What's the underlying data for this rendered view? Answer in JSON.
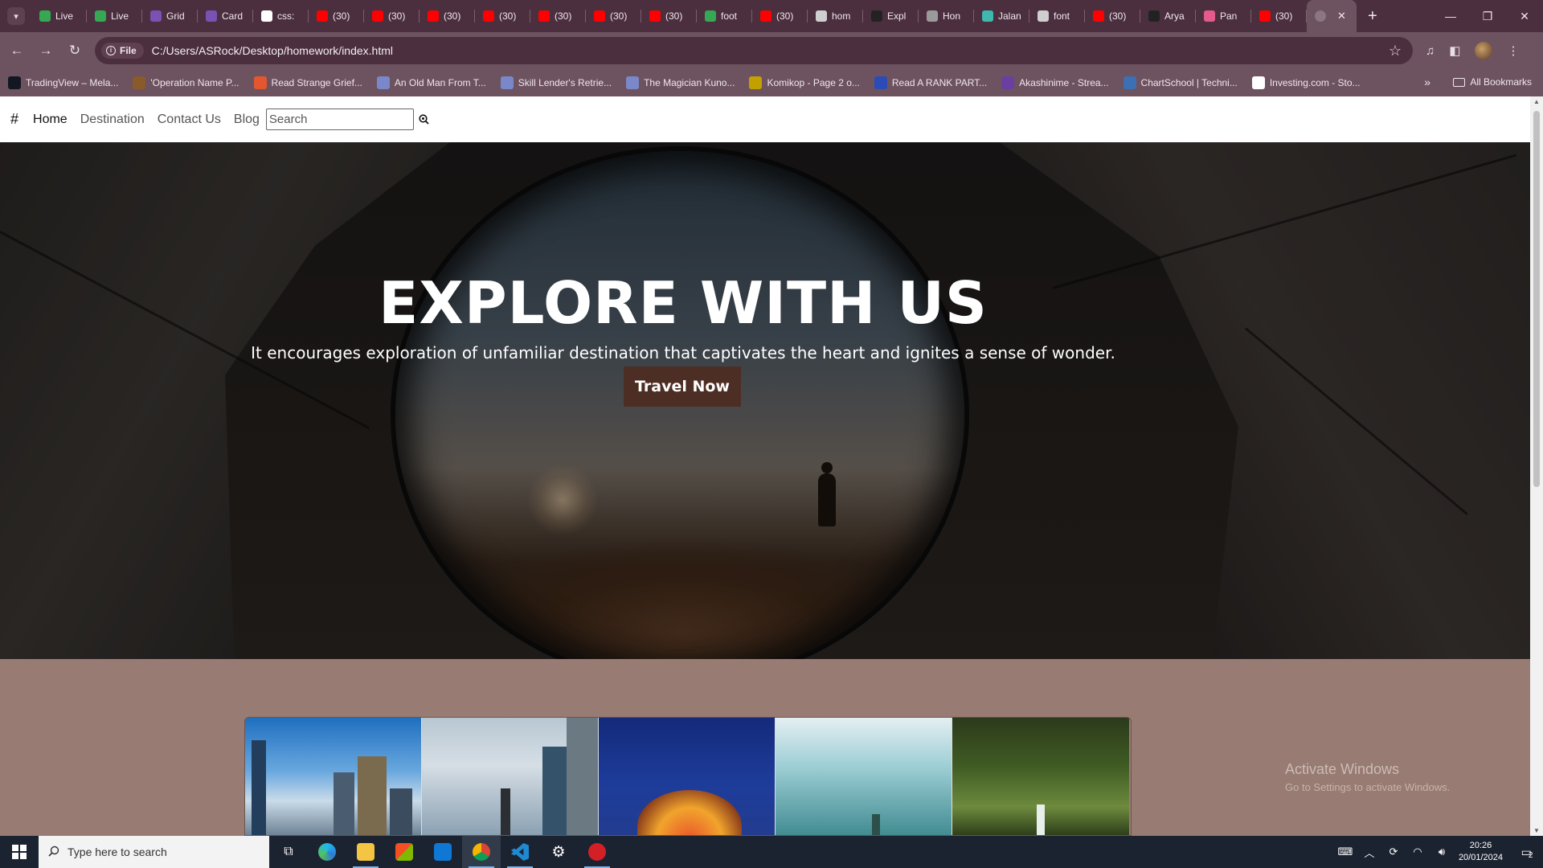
{
  "browser": {
    "tabs": [
      {
        "label": "Live",
        "icon": "google-drive-icon",
        "color": "#34a853"
      },
      {
        "label": "Live",
        "icon": "google-drive-icon",
        "color": "#34a853"
      },
      {
        "label": "Grid",
        "icon": "bootstrap-icon",
        "color": "#7952b3"
      },
      {
        "label": "Card",
        "icon": "bootstrap-icon",
        "color": "#7952b3"
      },
      {
        "label": "css:",
        "icon": "c-icon",
        "color": "#ffffff"
      },
      {
        "label": "(30)",
        "icon": "youtube-icon",
        "color": "#ff0000"
      },
      {
        "label": "(30)",
        "icon": "youtube-icon",
        "color": "#ff0000"
      },
      {
        "label": "(30)",
        "icon": "youtube-icon",
        "color": "#ff0000"
      },
      {
        "label": "(30)",
        "icon": "youtube-icon",
        "color": "#ff0000"
      },
      {
        "label": "(30)",
        "icon": "youtube-icon",
        "color": "#ff0000"
      },
      {
        "label": "(30)",
        "icon": "youtube-icon",
        "color": "#ff0000"
      },
      {
        "label": "(30)",
        "icon": "youtube-icon",
        "color": "#ff0000"
      },
      {
        "label": "foot",
        "icon": "google-drive-icon",
        "color": "#34a853"
      },
      {
        "label": "(30)",
        "icon": "youtube-icon",
        "color": "#ff0000"
      },
      {
        "label": "hom",
        "icon": "radio-icon",
        "color": "#cfcfcf"
      },
      {
        "label": "Expl",
        "icon": "github-icon",
        "color": "#222222"
      },
      {
        "label": "Hon",
        "icon": "globe-icon",
        "color": "#9a9a9a"
      },
      {
        "label": "Jalan",
        "icon": "d-icon",
        "color": "#3fb8af"
      },
      {
        "label": "font",
        "icon": "code-icon",
        "color": "#cfcfcf"
      },
      {
        "label": "(30)",
        "icon": "youtube-icon",
        "color": "#ff0000"
      },
      {
        "label": "Arya",
        "icon": "github-icon",
        "color": "#222222"
      },
      {
        "label": "Pan",
        "icon": "pan-icon",
        "color": "#e45b8b"
      },
      {
        "label": "(30)",
        "icon": "youtube-icon",
        "color": "#ff0000"
      }
    ],
    "active_tab_icon": "globe-icon",
    "address": {
      "chip": "File",
      "url": "C:/Users/ASRock/Desktop/homework/index.html"
    },
    "bookmarks": [
      {
        "label": "TradingView – Mela...",
        "icon": "tradingview-icon",
        "color": "#131722"
      },
      {
        "label": "'Operation Name P...",
        "icon": "book-icon",
        "color": "#8a5a2b"
      },
      {
        "label": "Read Strange Grief...",
        "icon": "k-icon",
        "color": "#e4572e"
      },
      {
        "label": "An Old Man From T...",
        "icon": "manga-icon",
        "color": "#7a88c9"
      },
      {
        "label": "Skill Lender's Retrie...",
        "icon": "manga-icon",
        "color": "#7a88c9"
      },
      {
        "label": "The Magician Kuno...",
        "icon": "manga-icon",
        "color": "#7a88c9"
      },
      {
        "label": "Komikop - Page 2 o...",
        "icon": "komik-icon",
        "color": "#c2a000"
      },
      {
        "label": "Read A RANK PART...",
        "icon": "rank-icon",
        "color": "#2a4bb8"
      },
      {
        "label": "Akashinime - Strea...",
        "icon": "akashi-icon",
        "color": "#6a3fa0"
      },
      {
        "label": "ChartSchool | Techni...",
        "icon": "chartschool-icon",
        "color": "#3c6fb3"
      },
      {
        "label": "Investing.com - Sto...",
        "icon": "investing-icon",
        "color": "#ffffff"
      }
    ],
    "all_bookmarks": "All Bookmarks"
  },
  "site": {
    "brand": "#",
    "nav": [
      "Home",
      "Destination",
      "Contact Us",
      "Blog"
    ],
    "search_placeholder": "Search",
    "hero": {
      "title": "EXPLORE WITH US",
      "text": "It encourages exploration of unfamiliar destination that captivates the heart and ignites a sense of wonder.",
      "button": "Travel Now"
    },
    "gallery_accent": "#987b72"
  },
  "watermark": {
    "title": "Activate Windows",
    "subtitle": "Go to Settings to activate Windows."
  },
  "taskbar": {
    "search_placeholder": "Type here to search",
    "time": "20:26",
    "date": "20/01/2024",
    "notification_count": "2"
  }
}
